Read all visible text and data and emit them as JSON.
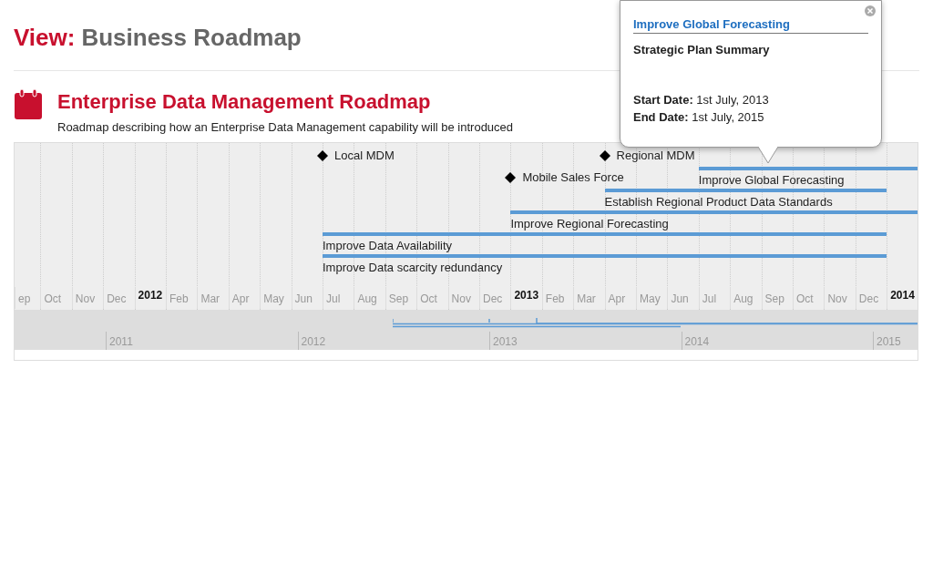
{
  "header": {
    "prefix": "View:",
    "title": "Business Roadmap"
  },
  "roadmap": {
    "title": "Enterprise Data Management Roadmap",
    "description": "Roadmap describing how an Enterprise Data Management capability will be introduced"
  },
  "timeline": {
    "ticks": [
      {
        "label": "ep",
        "kind": "month"
      },
      {
        "label": "Oct",
        "kind": "month"
      },
      {
        "label": "Nov",
        "kind": "month"
      },
      {
        "label": "Dec",
        "kind": "month"
      },
      {
        "label": "2012",
        "kind": "year"
      },
      {
        "label": "Feb",
        "kind": "month"
      },
      {
        "label": "Mar",
        "kind": "month"
      },
      {
        "label": "Apr",
        "kind": "month"
      },
      {
        "label": "May",
        "kind": "month"
      },
      {
        "label": "Jun",
        "kind": "month"
      },
      {
        "label": "Jul",
        "kind": "month"
      },
      {
        "label": "Aug",
        "kind": "month"
      },
      {
        "label": "Sep",
        "kind": "month"
      },
      {
        "label": "Oct",
        "kind": "month"
      },
      {
        "label": "Nov",
        "kind": "month"
      },
      {
        "label": "Dec",
        "kind": "month"
      },
      {
        "label": "2013",
        "kind": "year"
      },
      {
        "label": "Feb",
        "kind": "month"
      },
      {
        "label": "Mar",
        "kind": "month"
      },
      {
        "label": "Apr",
        "kind": "month"
      },
      {
        "label": "May",
        "kind": "month"
      },
      {
        "label": "Jun",
        "kind": "month"
      },
      {
        "label": "Jul",
        "kind": "month"
      },
      {
        "label": "Aug",
        "kind": "month"
      },
      {
        "label": "Sep",
        "kind": "month"
      },
      {
        "label": "Oct",
        "kind": "month"
      },
      {
        "label": "Nov",
        "kind": "month"
      },
      {
        "label": "Dec",
        "kind": "month"
      },
      {
        "label": "2014",
        "kind": "year"
      }
    ],
    "rows": [
      {
        "cells": [
          {
            "kind": "empty"
          },
          {
            "kind": "empty"
          },
          {
            "kind": "empty"
          },
          {
            "kind": "empty"
          },
          {
            "kind": "empty"
          },
          {
            "kind": "empty"
          },
          {
            "kind": "empty"
          },
          {
            "kind": "empty"
          },
          {
            "kind": "empty"
          },
          {
            "kind": "empty"
          },
          {
            "kind": "milestone",
            "label": "Local MDM"
          },
          {
            "kind": "empty"
          },
          {
            "kind": "empty"
          },
          {
            "kind": "empty"
          },
          {
            "kind": "empty"
          },
          {
            "kind": "empty"
          },
          {
            "kind": "empty"
          },
          {
            "kind": "empty"
          },
          {
            "kind": "empty"
          },
          {
            "kind": "milestone",
            "label": "Regional MDM"
          },
          {
            "kind": "empty"
          },
          {
            "kind": "empty"
          },
          {
            "kind": "empty"
          },
          {
            "kind": "empty"
          },
          {
            "kind": "empty"
          },
          {
            "kind": "empty"
          },
          {
            "kind": "empty"
          },
          {
            "kind": "empty"
          },
          {
            "kind": "empty"
          },
          {
            "kind": "empty"
          }
        ]
      },
      {
        "cells": [
          {
            "kind": "empty"
          },
          {
            "kind": "empty"
          },
          {
            "kind": "empty"
          },
          {
            "kind": "empty"
          },
          {
            "kind": "empty"
          },
          {
            "kind": "empty"
          },
          {
            "kind": "empty"
          },
          {
            "kind": "empty"
          },
          {
            "kind": "empty"
          },
          {
            "kind": "empty"
          },
          {
            "kind": "empty"
          },
          {
            "kind": "empty"
          },
          {
            "kind": "empty"
          },
          {
            "kind": "empty"
          },
          {
            "kind": "empty"
          },
          {
            "kind": "empty"
          },
          {
            "kind": "milestone",
            "label": "Mobile Sales Force"
          },
          {
            "kind": "empty"
          },
          {
            "kind": "empty"
          },
          {
            "kind": "empty"
          },
          {
            "kind": "empty"
          },
          {
            "kind": "empty"
          },
          {
            "kind": "bar",
            "label": "Improve Global Forecasting"
          },
          {
            "kind": "bar"
          },
          {
            "kind": "bar"
          },
          {
            "kind": "bar"
          },
          {
            "kind": "bar"
          },
          {
            "kind": "bar"
          },
          {
            "kind": "bar"
          },
          {
            "kind": "bar"
          }
        ]
      },
      {
        "cells": [
          {
            "kind": "empty"
          },
          {
            "kind": "empty"
          },
          {
            "kind": "empty"
          },
          {
            "kind": "empty"
          },
          {
            "kind": "empty"
          },
          {
            "kind": "empty"
          },
          {
            "kind": "empty"
          },
          {
            "kind": "empty"
          },
          {
            "kind": "empty"
          },
          {
            "kind": "empty"
          },
          {
            "kind": "empty"
          },
          {
            "kind": "empty"
          },
          {
            "kind": "empty"
          },
          {
            "kind": "empty"
          },
          {
            "kind": "empty"
          },
          {
            "kind": "empty"
          },
          {
            "kind": "empty"
          },
          {
            "kind": "empty"
          },
          {
            "kind": "empty"
          },
          {
            "kind": "bar",
            "label": "Establish Regional Product Data Standards"
          },
          {
            "kind": "bar"
          },
          {
            "kind": "bar"
          },
          {
            "kind": "bar"
          },
          {
            "kind": "bar"
          },
          {
            "kind": "bar"
          },
          {
            "kind": "bar"
          },
          {
            "kind": "bar"
          },
          {
            "kind": "bar"
          },
          {
            "kind": "empty"
          },
          {
            "kind": "empty"
          }
        ]
      },
      {
        "cells": [
          {
            "kind": "empty"
          },
          {
            "kind": "empty"
          },
          {
            "kind": "empty"
          },
          {
            "kind": "empty"
          },
          {
            "kind": "empty"
          },
          {
            "kind": "empty"
          },
          {
            "kind": "empty"
          },
          {
            "kind": "empty"
          },
          {
            "kind": "empty"
          },
          {
            "kind": "empty"
          },
          {
            "kind": "empty"
          },
          {
            "kind": "empty"
          },
          {
            "kind": "empty"
          },
          {
            "kind": "empty"
          },
          {
            "kind": "empty"
          },
          {
            "kind": "empty"
          },
          {
            "kind": "bar",
            "label": "Improve Regional Forecasting"
          },
          {
            "kind": "bar"
          },
          {
            "kind": "bar"
          },
          {
            "kind": "bar"
          },
          {
            "kind": "bar"
          },
          {
            "kind": "bar"
          },
          {
            "kind": "bar"
          },
          {
            "kind": "bar"
          },
          {
            "kind": "bar"
          },
          {
            "kind": "bar"
          },
          {
            "kind": "bar"
          },
          {
            "kind": "bar"
          },
          {
            "kind": "bar"
          },
          {
            "kind": "bar"
          }
        ]
      },
      {
        "cells": [
          {
            "kind": "empty"
          },
          {
            "kind": "empty"
          },
          {
            "kind": "empty"
          },
          {
            "kind": "empty"
          },
          {
            "kind": "empty"
          },
          {
            "kind": "empty"
          },
          {
            "kind": "empty"
          },
          {
            "kind": "empty"
          },
          {
            "kind": "empty"
          },
          {
            "kind": "empty"
          },
          {
            "kind": "bar",
            "label": "Improve Data Availability"
          },
          {
            "kind": "bar"
          },
          {
            "kind": "bar"
          },
          {
            "kind": "bar"
          },
          {
            "kind": "bar"
          },
          {
            "kind": "bar"
          },
          {
            "kind": "bar"
          },
          {
            "kind": "bar"
          },
          {
            "kind": "bar"
          },
          {
            "kind": "bar"
          },
          {
            "kind": "bar"
          },
          {
            "kind": "bar"
          },
          {
            "kind": "bar"
          },
          {
            "kind": "bar"
          },
          {
            "kind": "bar"
          },
          {
            "kind": "bar"
          },
          {
            "kind": "bar"
          },
          {
            "kind": "bar"
          },
          {
            "kind": "empty"
          },
          {
            "kind": "empty"
          }
        ]
      },
      {
        "cells": [
          {
            "kind": "empty"
          },
          {
            "kind": "empty"
          },
          {
            "kind": "empty"
          },
          {
            "kind": "empty"
          },
          {
            "kind": "empty"
          },
          {
            "kind": "empty"
          },
          {
            "kind": "empty"
          },
          {
            "kind": "empty"
          },
          {
            "kind": "empty"
          },
          {
            "kind": "empty"
          },
          {
            "kind": "bar",
            "label": "Improve Data scarcity redundancy"
          },
          {
            "kind": "bar"
          },
          {
            "kind": "bar"
          },
          {
            "kind": "bar"
          },
          {
            "kind": "bar"
          },
          {
            "kind": "bar"
          },
          {
            "kind": "bar"
          },
          {
            "kind": "bar"
          },
          {
            "kind": "bar"
          },
          {
            "kind": "bar"
          },
          {
            "kind": "bar"
          },
          {
            "kind": "bar"
          },
          {
            "kind": "bar"
          },
          {
            "kind": "bar"
          },
          {
            "kind": "bar"
          },
          {
            "kind": "bar"
          },
          {
            "kind": "bar"
          },
          {
            "kind": "bar"
          },
          {
            "kind": "empty"
          },
          {
            "kind": "empty"
          }
        ]
      }
    ],
    "overview_years": [
      "2011",
      "2012",
      "2013",
      "2014",
      "2015"
    ]
  },
  "tooltip": {
    "title": "Improve Global Forecasting",
    "subtitle": "Strategic Plan Summary",
    "lines": [
      "**Start Date:** 1st July, 2013",
      "**End Date:** 1st July, 2015"
    ]
  }
}
